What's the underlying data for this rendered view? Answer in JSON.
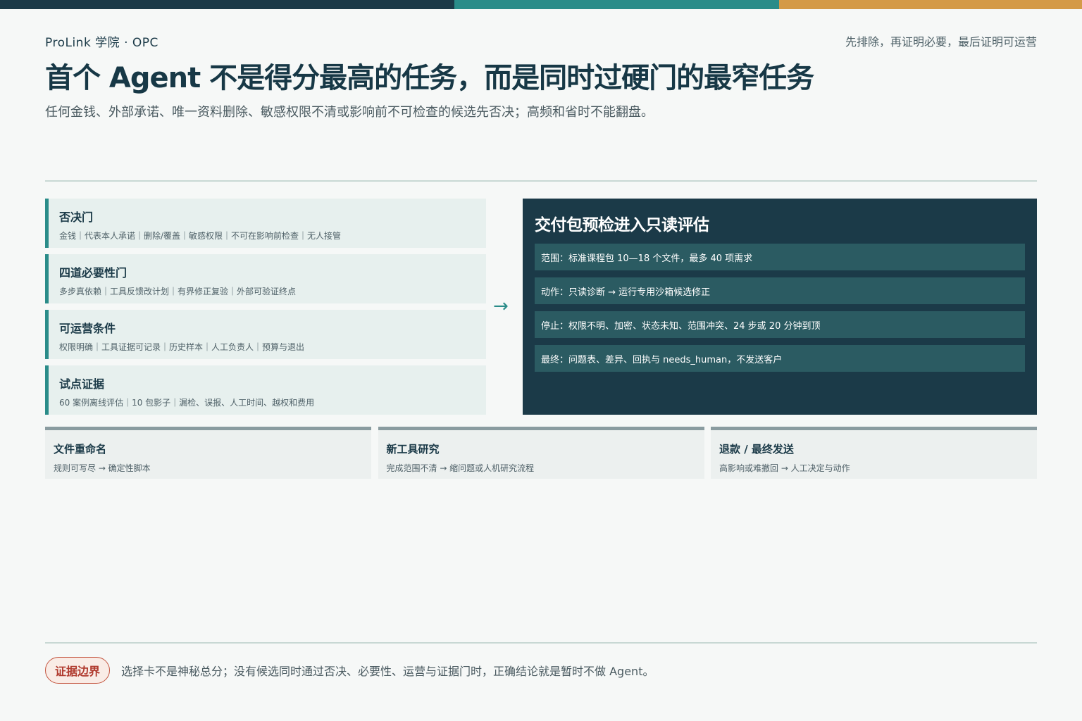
{
  "colors": {
    "navy": "#1b3a48",
    "teal": "#2a8c89",
    "amber": "#d49a48",
    "alert_red": "#b03a2e"
  },
  "header": {
    "brand": "ProLink 学院 · OPC",
    "slogan": "先排除，再证明必要，最后证明可运营",
    "title": "首个 Agent 不是得分最高的任务，而是同时过硬门的最窄任务",
    "subtitle": "任何金钱、外部承诺、唯一资料删除、敏感权限不清或影响前不可检查的候选先否决；高频和省时不能翻盘。"
  },
  "gates": [
    {
      "title": "否决门",
      "desc": "金钱｜代表本人承诺｜删除/覆盖｜敏感权限｜不可在影响前检查｜无人接管"
    },
    {
      "title": "四道必要性门",
      "desc": "多步真依赖｜工具反馈改计划｜有界修正复验｜外部可验证终点"
    },
    {
      "title": "可运营条件",
      "desc": "权限明确｜工具证据可记录｜历史样本｜人工负责人｜预算与退出"
    },
    {
      "title": "试点证据",
      "desc": "60 案例离线评估｜10 包影子｜漏检、误报、人工时间、越权和费用"
    }
  ],
  "arrow": "→",
  "panel": {
    "title": "交付包预检进入只读评估",
    "rows": [
      "范围：标准课程包 10—18 个文件，最多 40 项需求",
      "动作：只读诊断 → 运行专用沙箱候选修正",
      "停止：权限不明、加密、状态未知、范围冲突、24 步或 20 分钟到顶",
      "最终：问题表、差异、回执与 needs_human，不发送客户"
    ]
  },
  "cards": [
    {
      "title": "文件重命名",
      "desc": "规则可写尽 → 确定性脚本"
    },
    {
      "title": "新工具研究",
      "desc": "完成范围不清 → 缩问题或人机研究流程"
    },
    {
      "title": "退款 / 最终发送",
      "desc": "高影响或难撤回 → 人工决定与动作"
    }
  ],
  "footer": {
    "badge": "证据边界",
    "text": "选择卡不是神秘总分；没有候选同时通过否决、必要性、运营与证据门时，正确结论就是暂时不做 Agent。"
  }
}
